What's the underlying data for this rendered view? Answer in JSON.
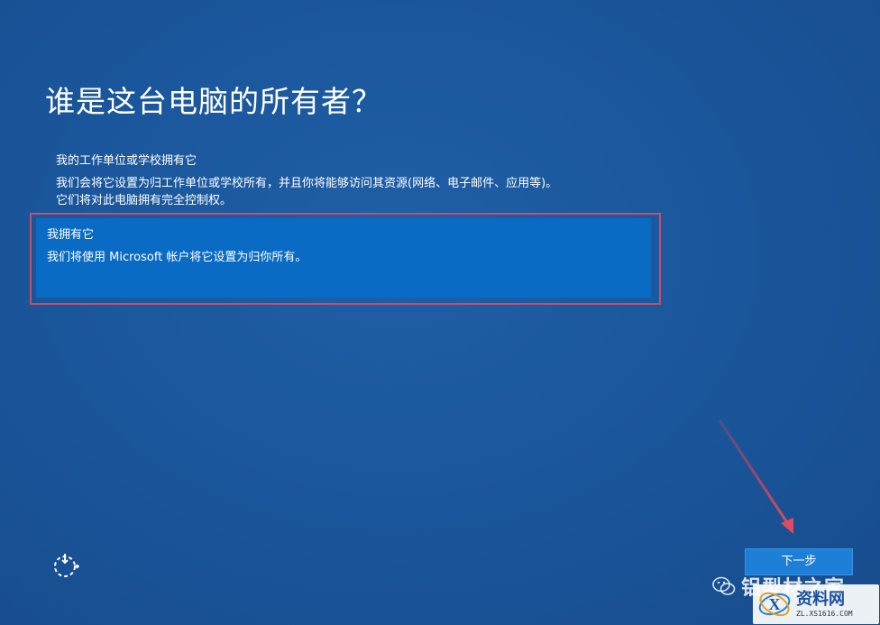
{
  "page": {
    "title": "谁是这台电脑的所有者？"
  },
  "options": {
    "work": {
      "title": "我的工作单位或学校拥有它",
      "desc_line1": "我们会将它设置为归工作单位或学校所有，并且你将能够访问其资源(网络、电子邮件、应用等)。",
      "desc_line2": "它们将对此电脑拥有完全控制权。"
    },
    "personal": {
      "title": "我拥有它",
      "desc": "我们将使用 Microsoft 帐户将它设置为归你所有。",
      "selected": true
    }
  },
  "footer": {
    "ease_of_access_icon": "ease-of-access-icon",
    "next_label": "下一步"
  },
  "watermark": {
    "account_text": "铝型材之家",
    "site_name": "资料网",
    "site_url": "ZL.XS1616.COM"
  },
  "colors": {
    "background": "#1a559a",
    "selected_option": "#0a6bc4",
    "highlight_border": "#c0506e",
    "next_button": "#1e7fd8",
    "annotation_arrow": "#d0405a"
  }
}
